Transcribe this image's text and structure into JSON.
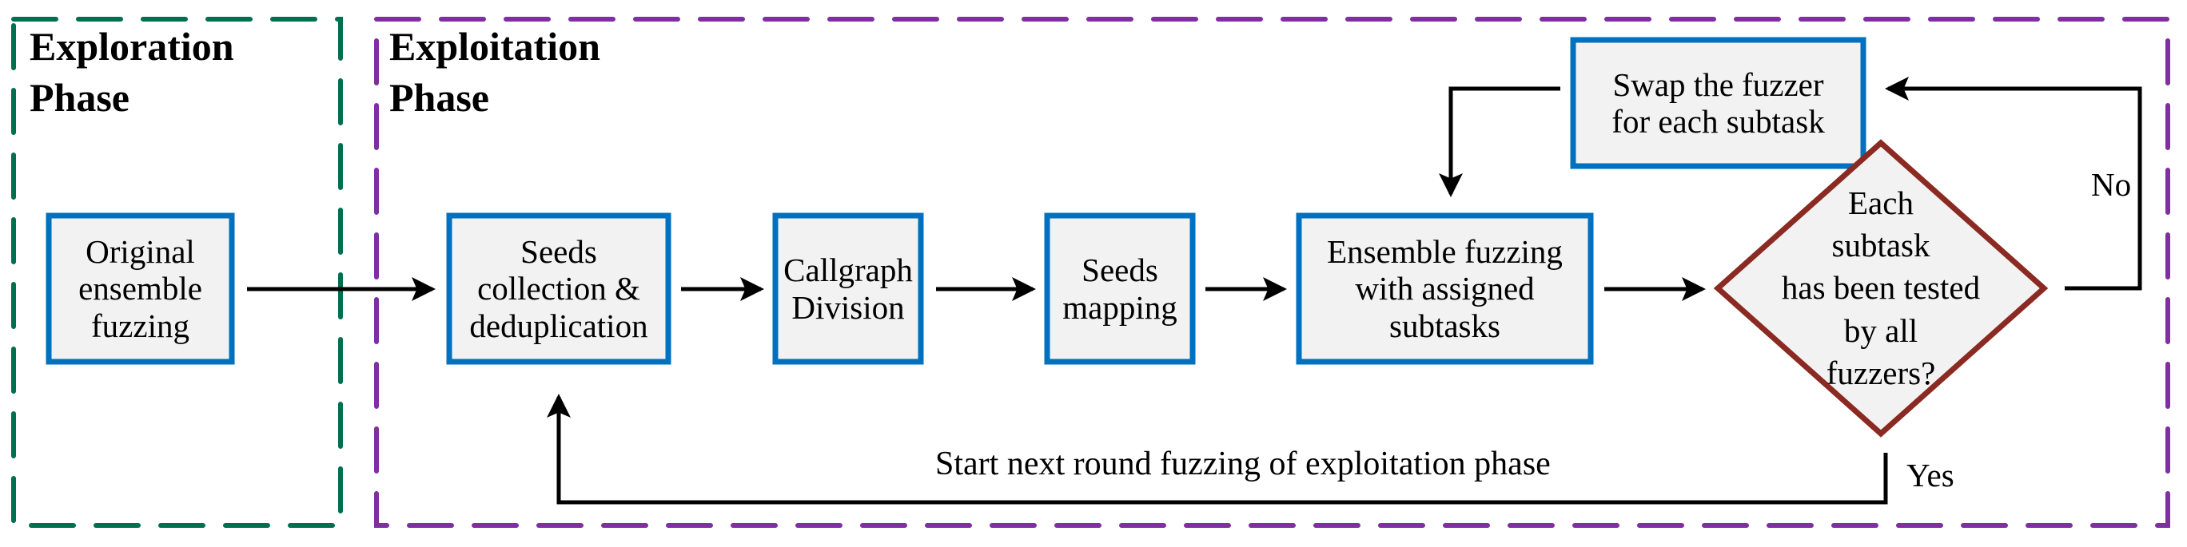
{
  "colors": {
    "exploration_frame": "#006f4f",
    "exploitation_frame": "#7f2fa0",
    "box_border": "#0070c0",
    "box_fill": "#f2f2f2",
    "decision_border": "#8b2a22",
    "arrow": "#000000"
  },
  "phases": {
    "exploration": {
      "title": "Exploration\nPhase"
    },
    "exploitation": {
      "title": "Exploitation\nPhase"
    }
  },
  "nodes": {
    "original": {
      "label": "Original\nensemble\nfuzzing"
    },
    "seeds_collection": {
      "label": "Seeds\ncollection &\ndeduplication"
    },
    "callgraph": {
      "label": "Callgraph\nDivision"
    },
    "seeds_mapping": {
      "label": "Seeds\nmapping"
    },
    "ensemble": {
      "label": "Ensemble fuzzing\nwith assigned\nsubtasks"
    },
    "swap": {
      "label": "Swap the fuzzer\nfor each subtask"
    },
    "decision": {
      "label": "Each\nsubtask\nhas been tested\nby all\nfuzzers?"
    }
  },
  "edge_labels": {
    "no": "No",
    "yes": "Yes",
    "loop": "Start next round fuzzing of exploitation phase"
  }
}
